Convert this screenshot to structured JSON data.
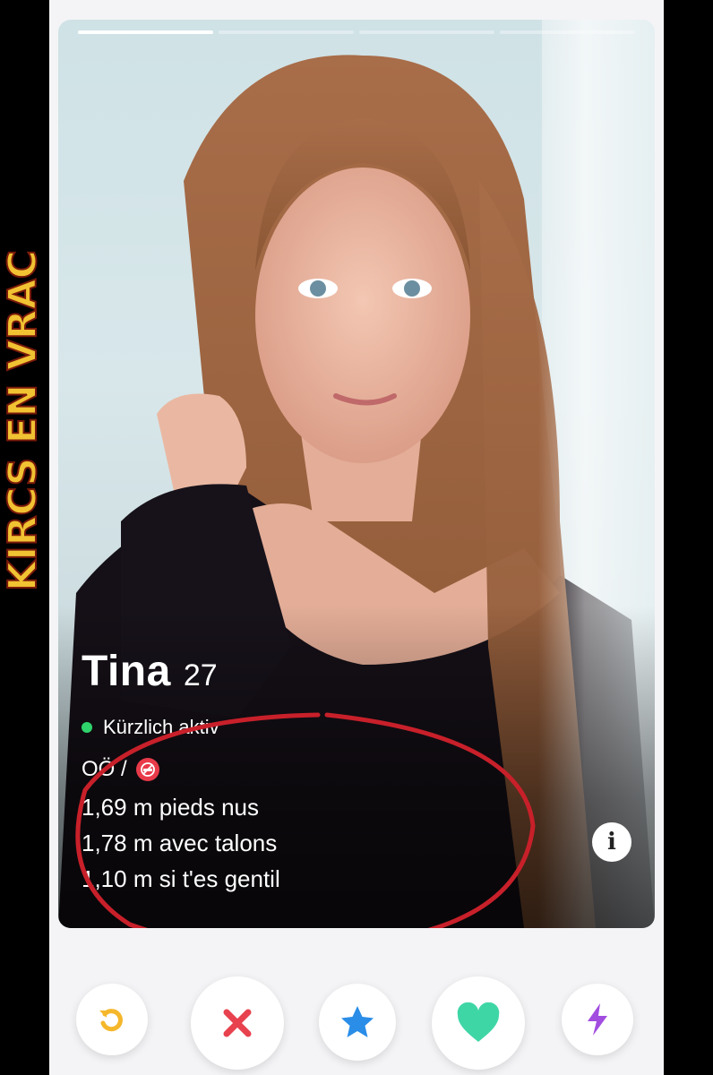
{
  "watermark": "KIRCS EN VRAC",
  "progress": {
    "segments": 4,
    "active_index": 0
  },
  "profile": {
    "name": "Tina",
    "age": "27",
    "status": "Kürzlich aktiv",
    "region": "OÖ /",
    "bio_lines": [
      "1,69 m pieds nus",
      "1,78 m avec talons",
      "1,10 m si t'es gentil"
    ]
  },
  "info_button": {
    "icon": "info-icon",
    "glyph": "i"
  },
  "actions": [
    {
      "name": "rewind-button",
      "icon": "rewind-icon",
      "color": "#f5b72b"
    },
    {
      "name": "nope-button",
      "icon": "x-icon",
      "color": "#e8424f"
    },
    {
      "name": "super-like-button",
      "icon": "star-icon",
      "color": "#2a8de8"
    },
    {
      "name": "like-button",
      "icon": "heart-icon",
      "color": "#3fd6a6"
    },
    {
      "name": "boost-button",
      "icon": "lightning-icon",
      "color": "#a24de0"
    }
  ],
  "colors": {
    "active_dot": "#2fd36b",
    "annotation_circle": "#c8202a",
    "no_smoking": "#e93a4a"
  }
}
